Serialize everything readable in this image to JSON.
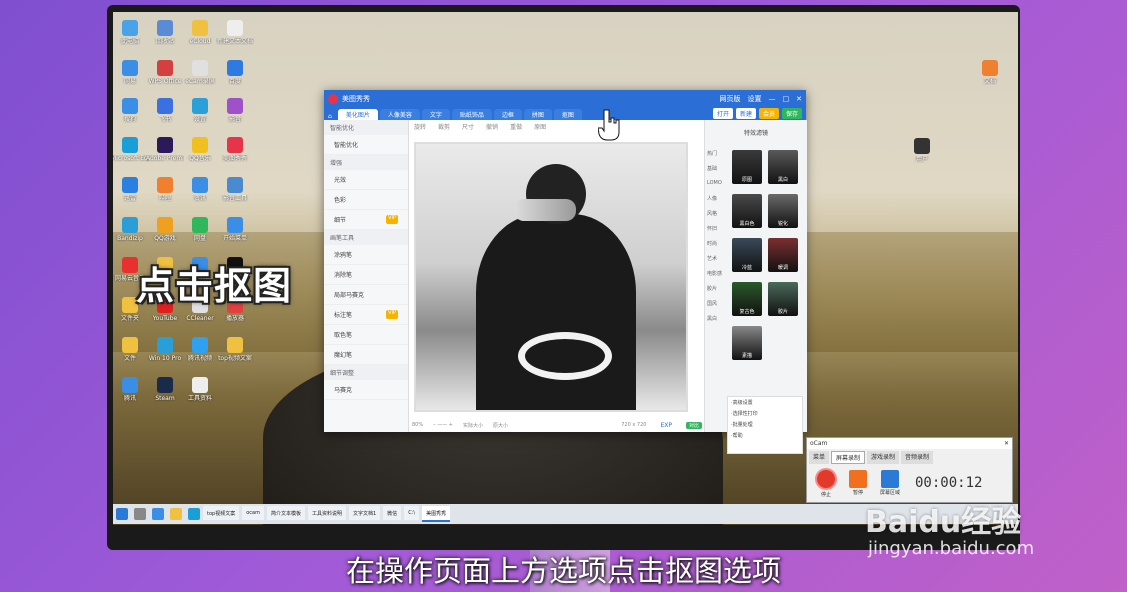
{
  "overlay": {
    "headline": "点击抠图",
    "caption": "在操作页面上方选项点击抠图选项",
    "watermark": "Baidu经验",
    "watermark_sub": "jingyan.baidu.com"
  },
  "desktop_icons": [
    {
      "label": "此电脑",
      "color": "#4aa3e8"
    },
    {
      "label": "回收站",
      "color": "#5b8ad6"
    },
    {
      "label": "eCloud",
      "color": "#f0c040"
    },
    {
      "label": "新建文本文档",
      "color": "#eeeeee"
    },
    {
      "label": "网易",
      "color": "#3a8ee6"
    },
    {
      "label": "WPS Office",
      "color": "#d43f3f"
    },
    {
      "label": "eCam录屏",
      "color": "#e0e0e0"
    },
    {
      "label": "百度",
      "color": "#2d7be0"
    },
    {
      "label": "搜狗",
      "color": "#3a8ee6"
    },
    {
      "label": "飞书",
      "color": "#3a70e0"
    },
    {
      "label": "设置",
      "color": "#2a9fd8"
    },
    {
      "label": "影音",
      "color": "#a050c8"
    },
    {
      "label": "Microsoft Edge",
      "color": "#1a9ed8"
    },
    {
      "label": "Adobe Premiere",
      "color": "#2a1a5a"
    },
    {
      "label": "QQ音乐",
      "color": "#f0c020"
    },
    {
      "label": "美图秀秀",
      "color": "#e8344a"
    },
    {
      "label": "迅雷",
      "color": "#2a80e0"
    },
    {
      "label": "哔哩",
      "color": "#f08030"
    },
    {
      "label": "资讯",
      "color": "#3a8ee6"
    },
    {
      "label": "影音工具",
      "color": "#4a8ad0"
    },
    {
      "label": "Bandizip",
      "color": "#2a9ed8"
    },
    {
      "label": "QQ游戏",
      "color": "#f0a020"
    },
    {
      "label": "网盘",
      "color": "#2eb75c"
    },
    {
      "label": "开始菜单",
      "color": "#3a8ee6"
    },
    {
      "label": "网易云音乐",
      "color": "#e83030"
    },
    {
      "label": "压缩",
      "color": "#f0c040"
    },
    {
      "label": "爱剪辑",
      "color": "#3a8ee6"
    },
    {
      "label": "抖音",
      "color": "#111111"
    },
    {
      "label": "文件夹",
      "color": "#f0c040"
    },
    {
      "label": "YouTube",
      "color": "#e02020"
    },
    {
      "label": "CCleaner",
      "color": "#e0e0e0"
    },
    {
      "label": "播放器",
      "color": "#e04040"
    },
    {
      "label": "文件",
      "color": "#f0c040"
    },
    {
      "label": "Win 10 Pro",
      "color": "#2a9ed8"
    },
    {
      "label": "腾讯视频",
      "color": "#30a0f0"
    },
    {
      "label": "top视频文案",
      "color": "#f0c040"
    },
    {
      "label": "腾讯",
      "color": "#3a8ee6"
    },
    {
      "label": "Steam",
      "color": "#1a2a4a"
    },
    {
      "label": "工具资料",
      "color": "#eeeeee"
    }
  ],
  "right_icons": [
    {
      "label": "文档",
      "color": "#f08030"
    },
    {
      "label": "用户",
      "color": "#333333"
    }
  ],
  "app": {
    "title": "美图秀秀",
    "titlebar_right": [
      "网页版",
      "设置"
    ],
    "tabs": [
      "美化图片",
      "人像美容",
      "文字",
      "贴纸饰品",
      "边框",
      "拼图",
      "抠图"
    ],
    "active_tab": 0,
    "actions": {
      "open": "打开",
      "new": "新建",
      "vip": "会员",
      "save": "保存"
    },
    "left_sections": [
      {
        "title": "智能优化",
        "items": [
          {
            "label": "智能优化",
            "vip": false
          }
        ]
      },
      {
        "title": "增强",
        "items": [
          {
            "label": "光效",
            "vip": false
          },
          {
            "label": "色彩",
            "vip": false
          },
          {
            "label": "细节",
            "vip": true
          }
        ]
      },
      {
        "title": "画笔工具",
        "items": [
          {
            "label": "涂鸦笔",
            "vip": false
          },
          {
            "label": "消除笔",
            "vip": false
          },
          {
            "label": "局部马赛克",
            "vip": false
          },
          {
            "label": "标注笔",
            "vip": true
          },
          {
            "label": "取色笔",
            "vip": false
          },
          {
            "label": "魔幻笔",
            "vip": false
          }
        ]
      },
      {
        "title": "细节调整",
        "items": [
          {
            "label": "马赛克",
            "vip": false
          }
        ]
      }
    ],
    "toolbar": [
      "旋转",
      "裁剪",
      "尺寸",
      "撤销",
      "重做",
      "原图"
    ],
    "statusbar": {
      "zoom": "80%",
      "fit": "实际大小",
      "fullscreen": "原大小",
      "size": "720 x 720",
      "compare": "对比",
      "export": "EXP"
    },
    "right_panel": {
      "title": "特效滤镜",
      "categories": [
        "热门",
        "基础",
        "LOMO",
        "人像",
        "风格",
        "怀旧",
        "时尚",
        "艺术",
        "电影感",
        "胶片",
        "国风",
        "黑白"
      ],
      "filters": [
        {
          "label": "原图",
          "color": "#3a3a3a"
        },
        {
          "label": "黑白",
          "color": "#5a5a5a"
        },
        {
          "label": "黑白色",
          "color": "#4a4a4a"
        },
        {
          "label": "锐化",
          "color": "#6a6a6a"
        },
        {
          "label": "冷蓝",
          "color": "#3a4a5a"
        },
        {
          "label": "暖调",
          "color": "#7a3030"
        },
        {
          "label": "复古色",
          "color": "#2a5a2a"
        },
        {
          "label": "胶片",
          "color": "#4a6a5a"
        },
        {
          "label": "素描",
          "color": "#888888"
        }
      ],
      "list": [
        "·高级设置",
        "·选择性打印",
        "·批量处理",
        "·帮助"
      ]
    }
  },
  "ocam": {
    "title": "oCam",
    "tabs": [
      "菜单",
      "屏幕录制",
      "游戏录制",
      "音频录制"
    ],
    "active_tab": 1,
    "buttons": [
      "停止",
      "暂停",
      "屏幕区域"
    ],
    "timer": "00:00:12"
  },
  "taskbar": {
    "apps": [
      "top视频文案",
      "ocam",
      "简介文本模板",
      "工具资料说明",
      "文字文档1",
      "微信",
      "C:\\",
      "美图秀秀"
    ],
    "active": 7
  }
}
